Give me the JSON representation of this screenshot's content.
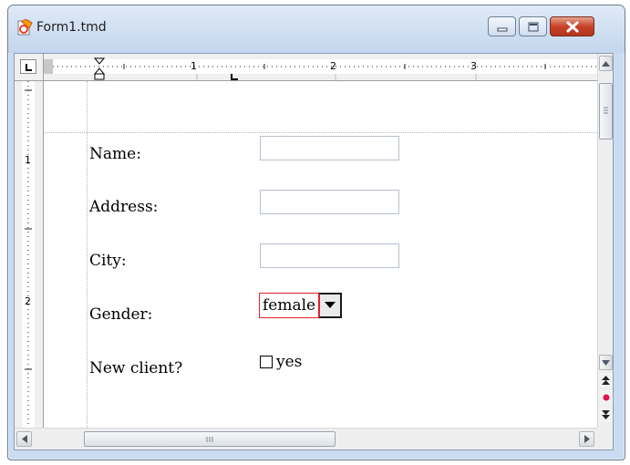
{
  "window": {
    "title": "Form1.tmd",
    "icon": "document-app-icon",
    "buttons": [
      "minimize-icon",
      "maximize-icon",
      "close-icon"
    ]
  },
  "ruler": {
    "horizontal_labels": [
      "1",
      "2",
      "3"
    ],
    "vertical_labels": [
      "1",
      "2"
    ]
  },
  "form": {
    "fields": [
      {
        "label": "Name:",
        "value": ""
      },
      {
        "label": "Address:",
        "value": ""
      },
      {
        "label": "City:",
        "value": ""
      }
    ],
    "gender": {
      "label": "Gender:",
      "selected": "female"
    },
    "new_client": {
      "label": "New client?",
      "checkbox_label": "yes",
      "checked": false
    }
  },
  "colors": {
    "focus_border": "#e0242c",
    "close_button": "#c7432a",
    "frame": "#c9dcf2"
  }
}
